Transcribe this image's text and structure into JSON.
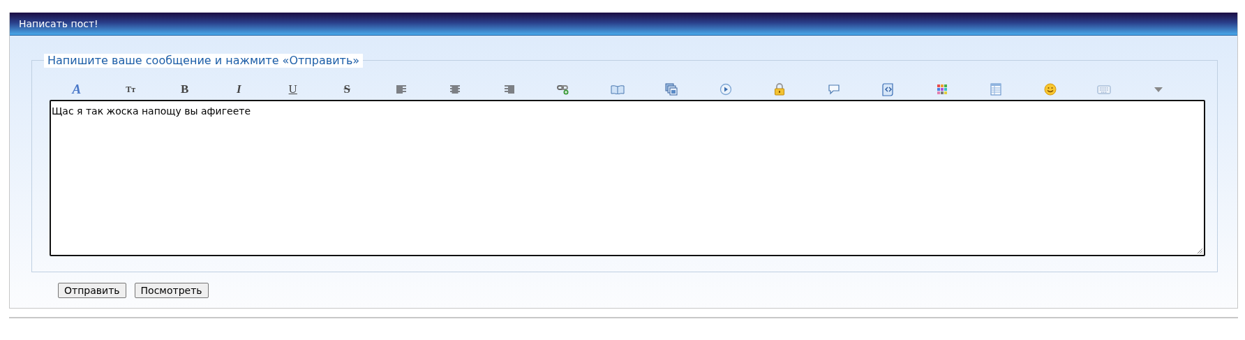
{
  "panel": {
    "title": "Написать пост!"
  },
  "form": {
    "legend": "Напишите ваше сообщение и нажмите «Отправить»",
    "toolbar": [
      {
        "kind": "font",
        "glyph": "A"
      },
      {
        "kind": "size",
        "glyph": "Tт"
      },
      {
        "kind": "bold",
        "glyph": "B"
      },
      {
        "kind": "italic",
        "glyph": "I"
      },
      {
        "kind": "underline",
        "glyph": "U"
      },
      {
        "kind": "strike",
        "glyph": "S"
      },
      {
        "kind": "align-left"
      },
      {
        "kind": "align-center"
      },
      {
        "kind": "align-right"
      },
      {
        "kind": "link"
      },
      {
        "kind": "book"
      },
      {
        "kind": "images"
      },
      {
        "kind": "media"
      },
      {
        "kind": "lock"
      },
      {
        "kind": "quote"
      },
      {
        "kind": "code"
      },
      {
        "kind": "colors"
      },
      {
        "kind": "table"
      },
      {
        "kind": "smiley"
      },
      {
        "kind": "keyboard"
      },
      {
        "kind": "more"
      }
    ],
    "message": "Щас я так жоска напощу вы афигеете"
  },
  "buttons": [
    "Отправить",
    "Посмотреть"
  ]
}
